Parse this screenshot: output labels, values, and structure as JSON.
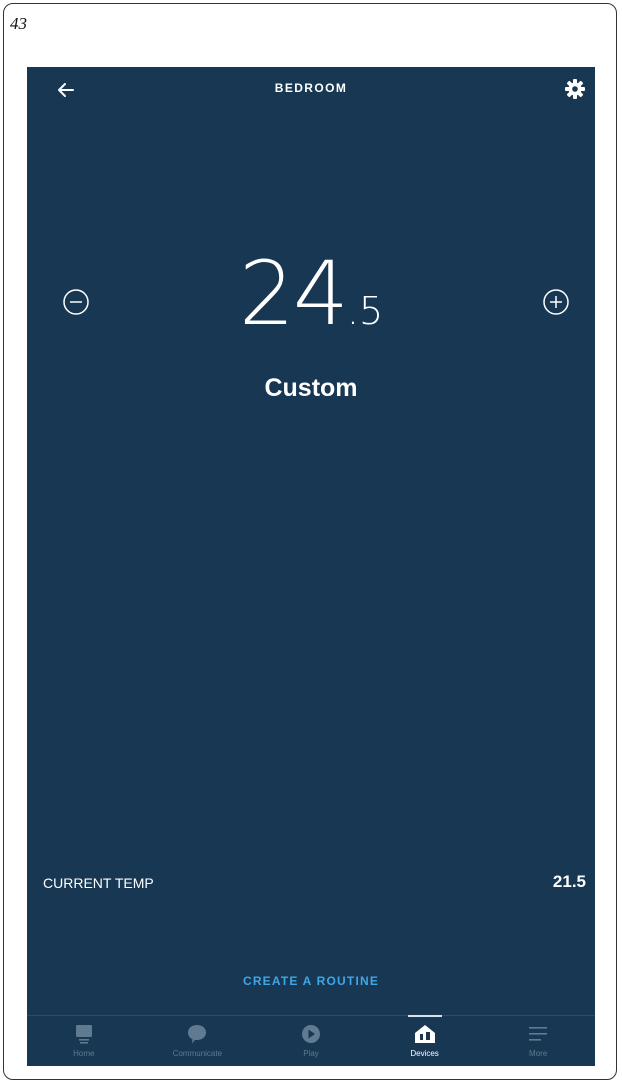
{
  "page_number": "43",
  "header": {
    "title": "BEDROOM"
  },
  "thermostat": {
    "setpoint_whole": "24",
    "setpoint_decimal": ".5",
    "mode": "Custom",
    "current_temp_label": "CURRENT TEMP",
    "current_temp_value": "21.5"
  },
  "actions": {
    "create_routine": "CREATE A ROUTINE"
  },
  "nav": {
    "items": [
      {
        "label": "Home",
        "icon": "home-icon"
      },
      {
        "label": "Communicate",
        "icon": "speech-bubble-icon"
      },
      {
        "label": "Play",
        "icon": "play-icon"
      },
      {
        "label": "Devices",
        "icon": "devices-house-icon"
      },
      {
        "label": "More",
        "icon": "menu-lines-icon"
      }
    ],
    "active": "Devices"
  },
  "colors": {
    "background": "#173753",
    "accent": "#3fa6e8",
    "inactive_nav": "#5f7a91",
    "text": "#ffffff"
  }
}
